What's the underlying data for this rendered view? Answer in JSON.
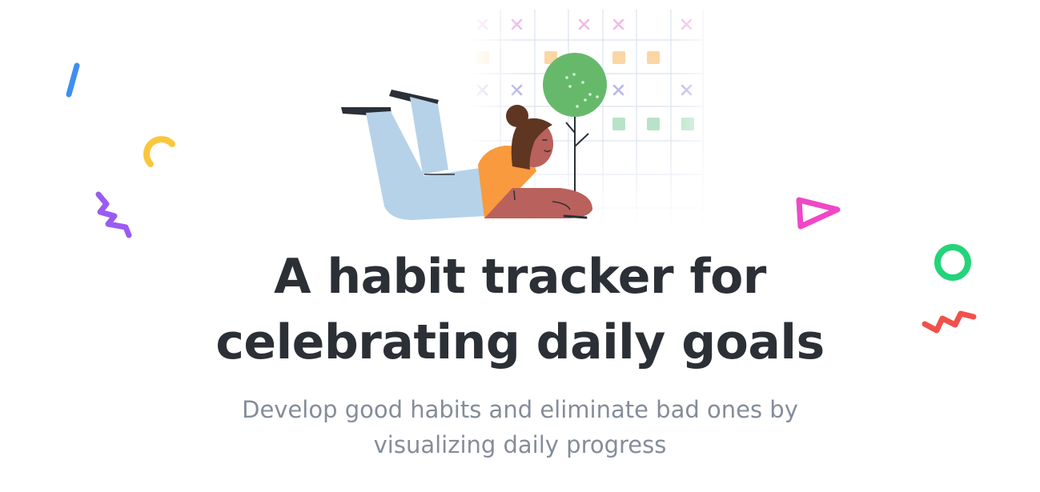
{
  "hero": {
    "headline_line1": "A habit tracker for",
    "headline_line2": "celebrating daily goals",
    "subhead_line1": "Develop good habits and eliminate bad ones by",
    "subhead_line2": "visualizing daily progress"
  },
  "colors": {
    "headline": "#2b2f36",
    "subhead": "#848d99",
    "tree_green": "#66b96b",
    "shirt_orange": "#f89a3d",
    "pants_blue": "#b6d2e8",
    "skin": "#b9615c",
    "grid_line": "#dde2f0",
    "mark_pink": "#f3b8e9",
    "mark_purple": "#b6b7ec",
    "square_orange": "#fbd6a5",
    "square_green": "#b8e3c8"
  },
  "decorations": [
    "blue-dash",
    "yellow-arc",
    "purple-zigzag",
    "pink-triangle",
    "green-ring",
    "red-zigzag"
  ]
}
